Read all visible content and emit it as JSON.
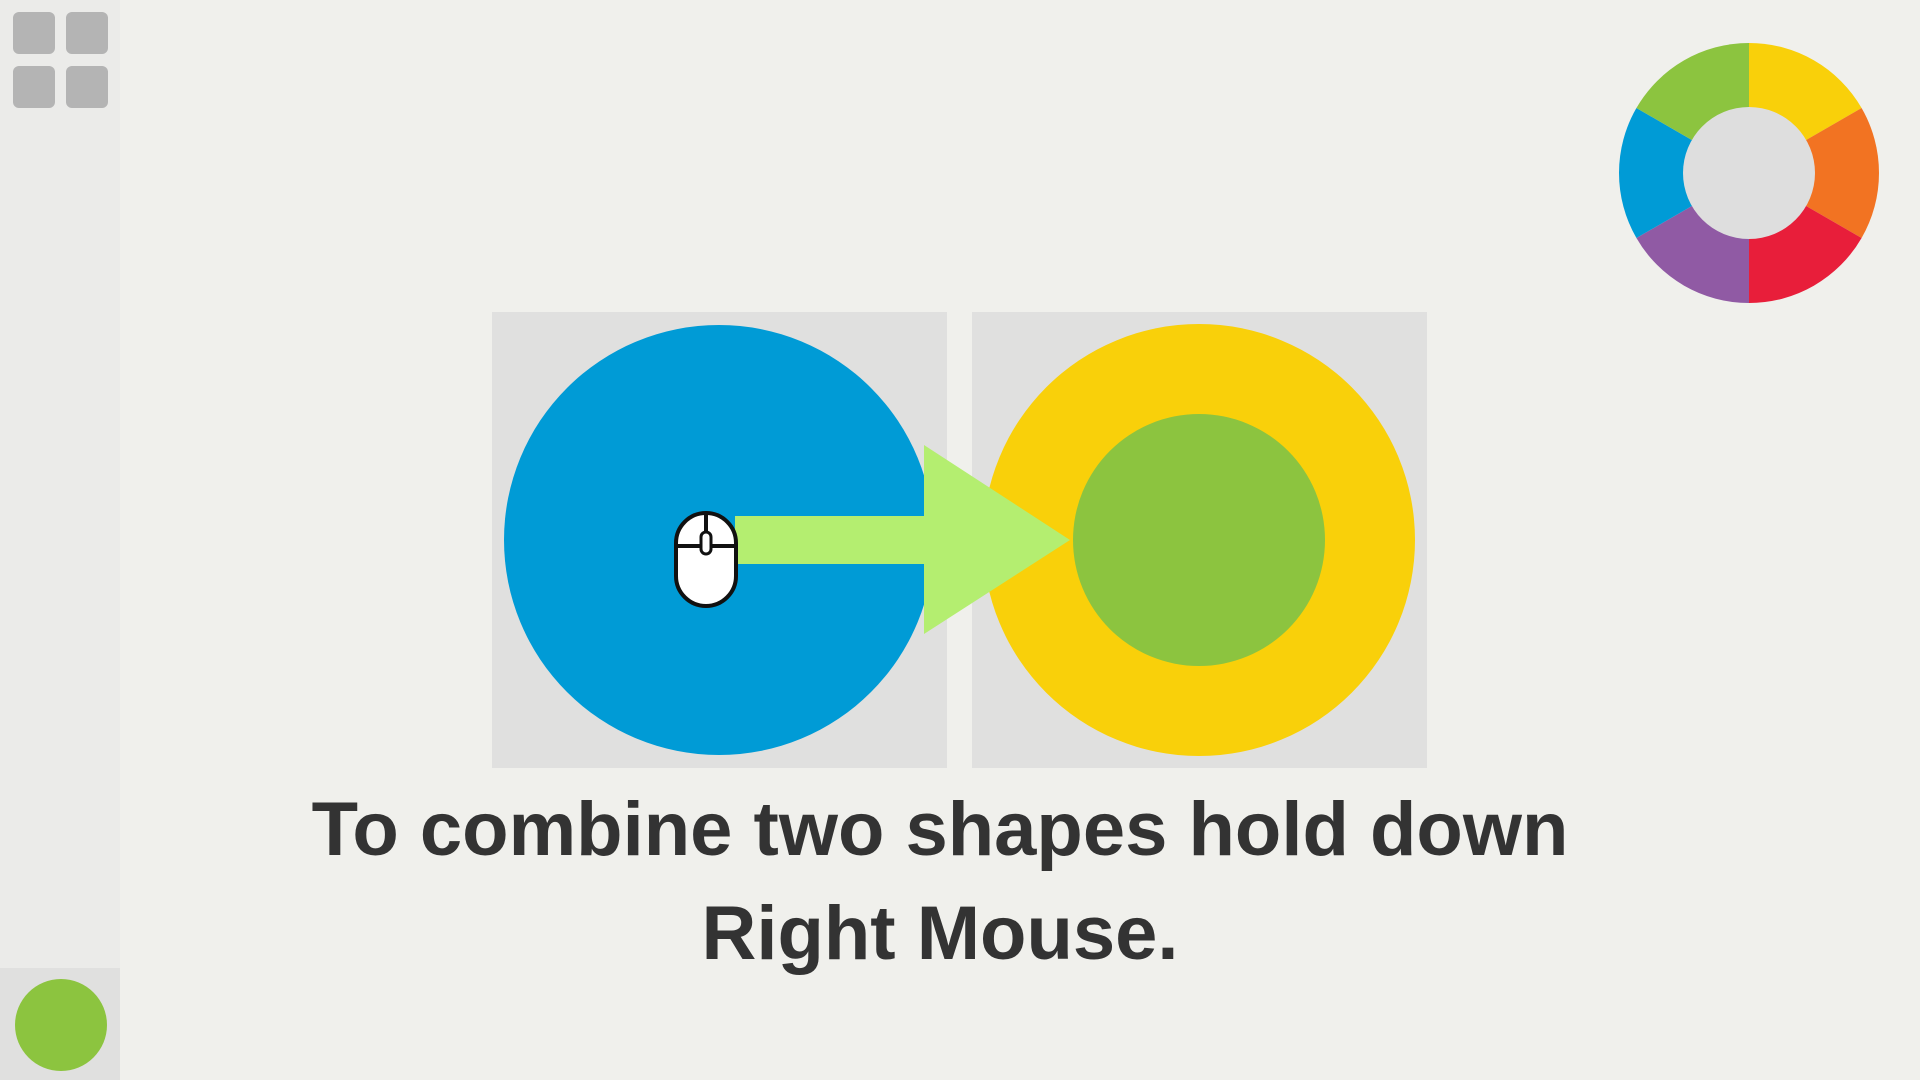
{
  "app": {
    "menu_icon": "grid-menu-icon",
    "current_shape": {
      "type": "circle",
      "color": "#8cc43f"
    }
  },
  "color_wheel": {
    "segments": [
      "#f9d00a",
      "#f27322",
      "#e81e3a",
      "#905aa4",
      "#009bd6",
      "#8cc43f"
    ],
    "center_color": "#dedede"
  },
  "tutorial": {
    "left_shape": {
      "type": "circle",
      "color": "#009bd6"
    },
    "right_shape": {
      "type": "ring",
      "outer_color": "#f9d00a",
      "inner_color": "#8cc43f"
    },
    "arrow_color": "#b4ee70",
    "input_icon": "mouse-right-button-icon",
    "instruction_line1": "To combine two shapes hold down",
    "instruction_line2": "Right Mouse."
  }
}
